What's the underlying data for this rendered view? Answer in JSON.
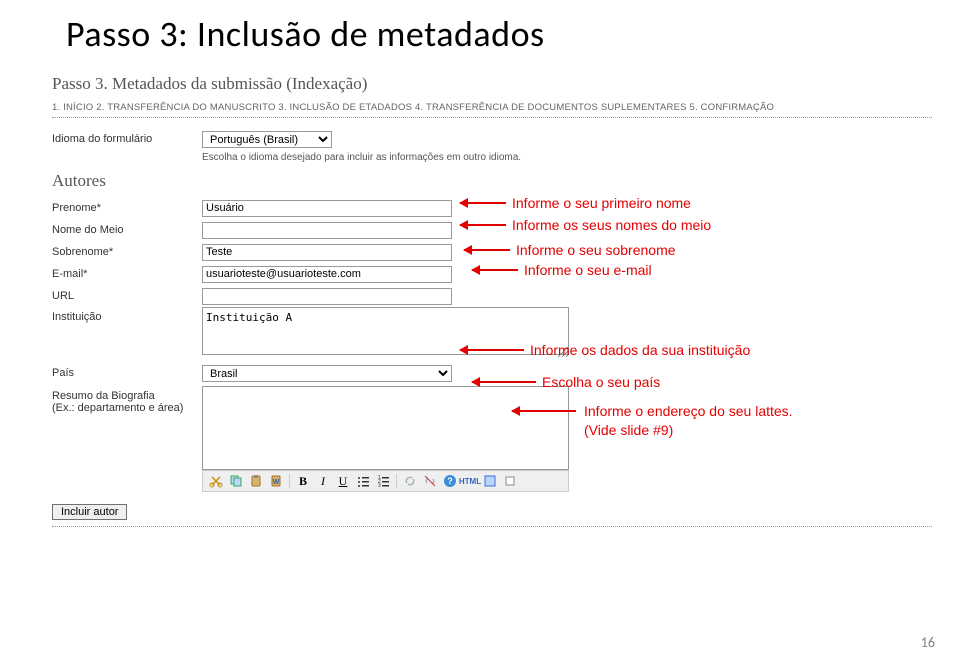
{
  "slide_title": "Passo 3: Inclusão de metadados",
  "header": {
    "section_title": "Passo 3. Metadados da submissão (Indexação)",
    "steps_line": "1. INÍCIO   2. TRANSFERÊNCIA DO MANUSCRITO   3. INCLUSÃO DE ETADADOS   4. TRANSFERÊNCIA DE DOCUMENTOS SUPLEMENTARES   5. CONFIRMAÇÃO"
  },
  "language": {
    "label": "Idioma do formulário",
    "value": "Português (Brasil)",
    "hint": "Escolha o idioma desejado para incluir as informações em outro idioma."
  },
  "autores_heading": "Autores",
  "fields": {
    "prenome": {
      "label": "Prenome*",
      "value": "Usuário"
    },
    "nome_meio": {
      "label": "Nome do Meio",
      "value": ""
    },
    "sobrenome": {
      "label": "Sobrenome*",
      "value": "Teste"
    },
    "email": {
      "label": "E-mail*",
      "value": "usuarioteste@usuarioteste.com"
    },
    "url": {
      "label": "URL",
      "value": ""
    },
    "instituicao": {
      "label": "Instituição",
      "value": "Instituição A"
    },
    "pais": {
      "label": "País",
      "value": "Brasil"
    },
    "biografia": {
      "label_line1": "Resumo da Biografia",
      "label_line2": "(Ex.: departamento e área)",
      "value": ""
    }
  },
  "button": {
    "incluir_autor": "Incluir autor"
  },
  "annotations": {
    "a1": "Informe o seu primeiro nome",
    "a2": "Informe os seus nomes do meio",
    "a3": "Informe o seu sobrenome",
    "a4": "Informe o seu e-mail",
    "a5": "Informe os dados da sua instituição",
    "a6": "Escolha o seu país",
    "a7_line1": "Informe o endereço do seu lattes.",
    "a7_line2": "(Vide slide #9)"
  },
  "page_number": "16"
}
